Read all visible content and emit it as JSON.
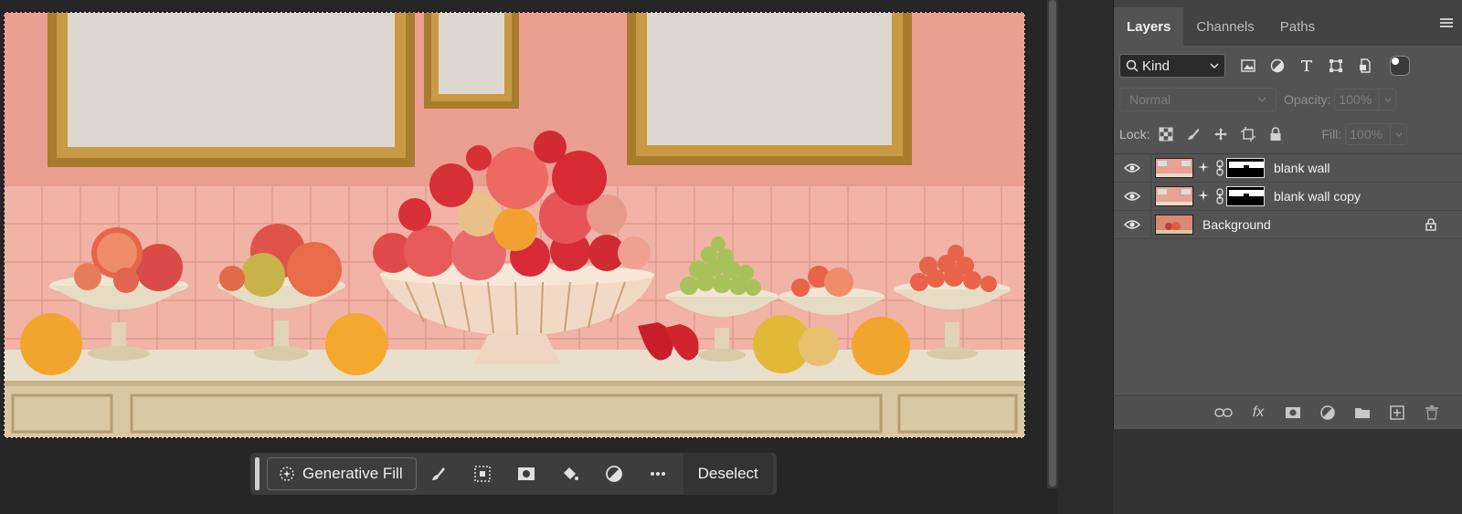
{
  "taskbar": {
    "generative_fill": "Generative Fill",
    "deselect": "Deselect"
  },
  "layers_panel": {
    "tabs": [
      {
        "label": "Layers",
        "active": true
      },
      {
        "label": "Channels",
        "active": false
      },
      {
        "label": "Paths",
        "active": false
      }
    ],
    "filter_kind": "Kind",
    "blend_mode": "Normal",
    "opacity_label": "Opacity:",
    "opacity_value": "100%",
    "lock_label": "Lock:",
    "fill_label": "Fill:",
    "fill_value": "100%",
    "layers": [
      {
        "name": "blank wall",
        "visible": true,
        "has_mask": true
      },
      {
        "name": "blank wall copy",
        "visible": true,
        "has_mask": true
      },
      {
        "name": "Background",
        "visible": true,
        "locked": true
      }
    ],
    "fx_label": "fx"
  },
  "colors": {
    "wall": "#e8a192",
    "tile": "#f0b3a5",
    "frame": "#b8862e",
    "panel_bg": "#535353",
    "app_bg": "#262626"
  }
}
